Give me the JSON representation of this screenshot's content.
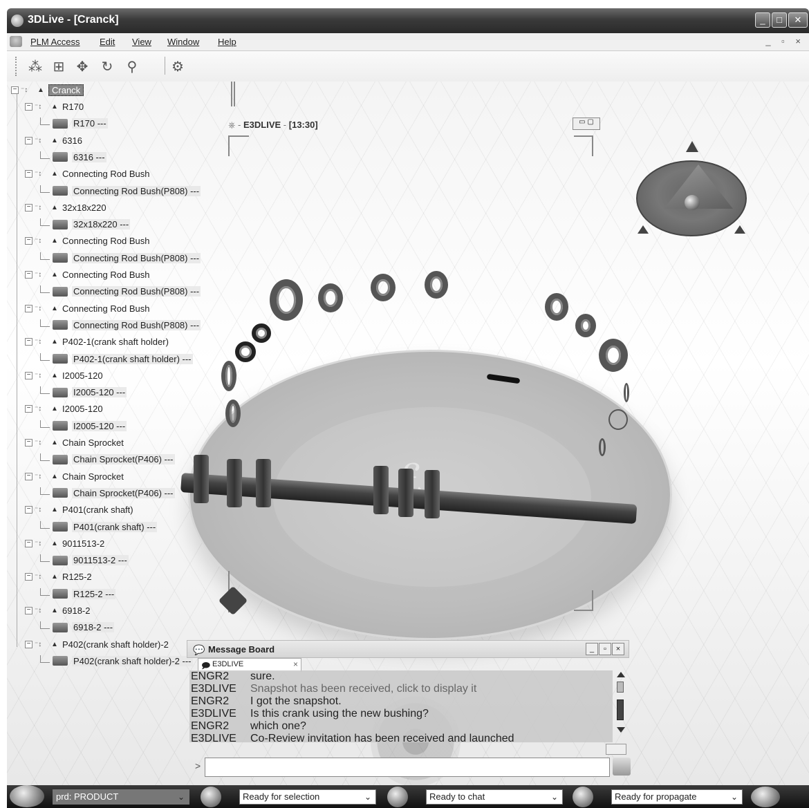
{
  "window": {
    "title": "3DLive - [Cranck]",
    "buttons": [
      "_",
      "□",
      "✕"
    ]
  },
  "menubar": {
    "items": [
      "PLM Access",
      "Edit",
      "View",
      "Window",
      "Help"
    ],
    "mdi_controls": "_ ▫ ×"
  },
  "toolbar": {
    "icons": [
      "hierarchy-icon",
      "fit-all-icon",
      "pan-icon",
      "rotate-icon",
      "zoom-icon",
      "settings-icon"
    ]
  },
  "tree": {
    "root": "Cranck",
    "nodes": [
      {
        "name": "R170",
        "instance": "R170 ---"
      },
      {
        "name": "6316",
        "instance": "6316 ---"
      },
      {
        "name": "Connecting Rod Bush",
        "instance": "Connecting Rod Bush(P808) ---"
      },
      {
        "name": "32x18x220",
        "instance": "32x18x220 ---"
      },
      {
        "name": "Connecting Rod Bush",
        "instance": "Connecting Rod Bush(P808) ---"
      },
      {
        "name": "Connecting Rod Bush",
        "instance": "Connecting Rod Bush(P808) ---"
      },
      {
        "name": "Connecting Rod Bush",
        "instance": "Connecting Rod Bush(P808) ---"
      },
      {
        "name": "P402-1(crank shaft holder)",
        "instance": "P402-1(crank shaft holder) ---"
      },
      {
        "name": "I2005-120",
        "instance": "I2005-120 ---"
      },
      {
        "name": "I2005-120",
        "instance": "I2005-120 ---"
      },
      {
        "name": "Chain Sprocket",
        "instance": "Chain Sprocket(P406) ---"
      },
      {
        "name": "Chain Sprocket",
        "instance": "Chain Sprocket(P406) ---"
      },
      {
        "name": "P401(crank shaft)",
        "instance": "P401(crank shaft) ---"
      },
      {
        "name": "9011513-2",
        "instance": "9011513-2 ---"
      },
      {
        "name": "R125-2",
        "instance": "R125-2 ---"
      },
      {
        "name": "6918-2",
        "instance": "6918-2 ---"
      },
      {
        "name": "P402(crank shaft holder)-2",
        "instance": "P402(crank shaft holder)-2 ---"
      }
    ]
  },
  "viewer": {
    "session_name": "E3DLIVE",
    "time": "[13:30]",
    "separator": "-"
  },
  "message_board": {
    "title": "Message Board",
    "tab": "E3DLIVE",
    "messages": [
      {
        "who": "ENGR2",
        "text": "sure.",
        "system": false
      },
      {
        "who": "E3DLIVE",
        "text": "Snapshot has been received, click to display it",
        "system": true
      },
      {
        "who": "ENGR2",
        "text": "I got the snapshot.",
        "system": false
      },
      {
        "who": "E3DLIVE",
        "text": "Is this crank using the new bushing?",
        "system": false
      },
      {
        "who": "ENGR2",
        "text": "which one?",
        "system": false
      },
      {
        "who": "E3DLIVE",
        "text": "Co-Review invitation has been received and launched",
        "system": false
      }
    ],
    "input_prompt": ">"
  },
  "statusbar": {
    "fields": [
      {
        "text": "prd: PRODUCT",
        "dropdown": "⌄"
      },
      {
        "text": "Ready for selection",
        "dropdown": "⌄"
      },
      {
        "text": "Ready to chat",
        "dropdown": "⌄"
      },
      {
        "text": "Ready for propagate",
        "dropdown": "⌄"
      }
    ]
  }
}
